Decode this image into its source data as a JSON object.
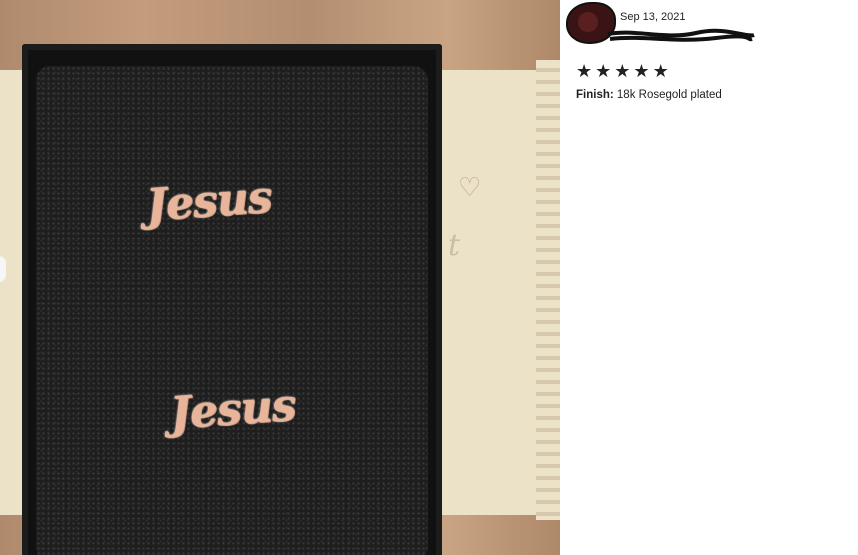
{
  "review": {
    "date": "Sep 13, 2021",
    "rating": 5,
    "stars": [
      "★",
      "★",
      "★",
      "★",
      "★"
    ],
    "finish_label": "Finish:",
    "finish_value": "18k Rosegold plated"
  },
  "photo": {
    "earring_text": "Jesus"
  },
  "colors": {
    "text": "#222222",
    "earring": "#e8b49a"
  }
}
